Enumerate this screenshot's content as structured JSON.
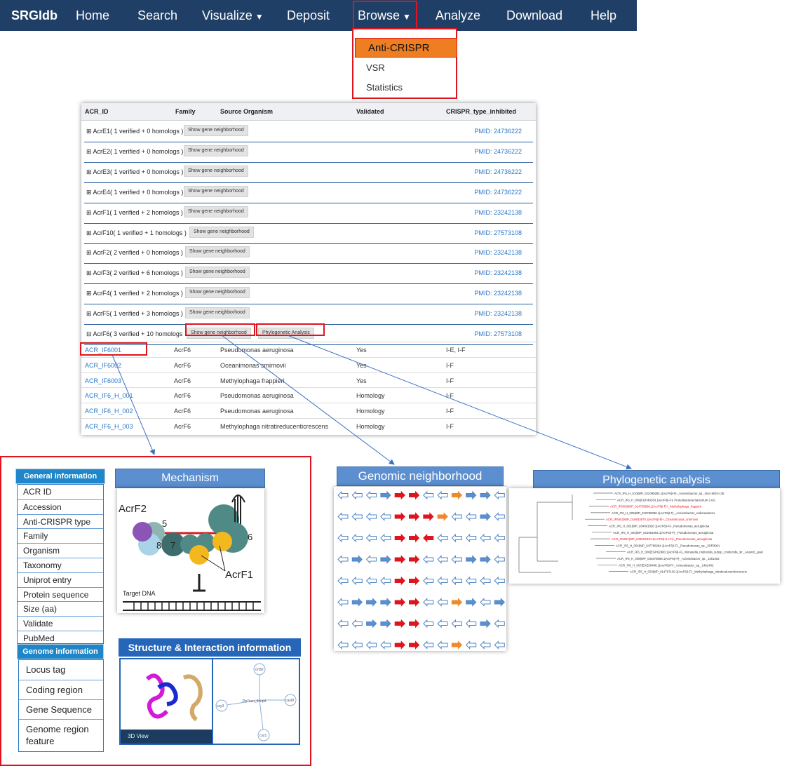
{
  "navbar": {
    "brand": "SRGIdb",
    "items": [
      "Home",
      "Search",
      "Visualize",
      "Deposit",
      "Browse",
      "Analyze",
      "Download",
      "Help"
    ]
  },
  "dropdown": {
    "items": [
      "Anti-CRISPR",
      "VSR",
      "Statistics"
    ]
  },
  "table": {
    "headers": [
      "ACR_ID",
      "Family",
      "Source Organism",
      "Validated",
      "CRISPR_type_inhibited"
    ],
    "groups": [
      {
        "label": "⊞ AcrE1( 1 verified + 0 homologs )",
        "pmid": "PMID: 24736222"
      },
      {
        "label": "⊞ AcrE2( 1 verified + 0 homologs )",
        "pmid": "PMID: 24736222"
      },
      {
        "label": "⊞ AcrE3( 1 verified + 0 homologs )",
        "pmid": "PMID: 24736222"
      },
      {
        "label": "⊞ AcrE4( 1 verified + 0 homologs )",
        "pmid": "PMID: 24736222"
      },
      {
        "label": "⊞ AcrF1( 1 verified + 2 homologs )",
        "pmid": "PMID: 23242138"
      },
      {
        "label": "⊞ AcrF10( 1 verified + 1 homologs )",
        "pmid": "PMID: 27573108"
      },
      {
        "label": "⊞ AcrF2( 2 verified + 0 homologs )",
        "pmid": "PMID: 23242138"
      },
      {
        "label": "⊞ AcrF3( 2 verified + 6 homologs )",
        "pmid": "PMID: 23242138"
      },
      {
        "label": "⊞ AcrF4( 1 verified + 2 homologs )",
        "pmid": "PMID: 23242138"
      },
      {
        "label": "⊞ AcrF5( 1 verified + 3 homologs )",
        "pmid": "PMID: 23242138"
      },
      {
        "label": "⊟ AcrF6( 3 verified + 10 homologs",
        "pmid": "PMID: 27573108"
      }
    ],
    "gene_button": "Show gene neighborhood",
    "phylo_button": "Phylogenetic Analysis",
    "rows": [
      {
        "id": "ACR_IF6001",
        "family": "AcrF6",
        "organism": "Pseudomonas aeruginosa",
        "validated": "Yes",
        "type": "I-E, I-F"
      },
      {
        "id": "ACR_IF6002",
        "family": "AcrF6",
        "organism": "Oceanimonas smirnovii",
        "validated": "Yes",
        "type": "I-F"
      },
      {
        "id": "ACR_IF6003",
        "family": "AcrF6",
        "organism": "Methylophaga frappieri",
        "validated": "Yes",
        "type": "I-F"
      },
      {
        "id": "ACR_IF6_H_001",
        "family": "AcrF6",
        "organism": "Pseudomonas aeruginosa",
        "validated": "Homology",
        "type": "I-F"
      },
      {
        "id": "ACR_IF6_H_002",
        "family": "AcrF6",
        "organism": "Pseudomonas aeruginosa",
        "validated": "Homology",
        "type": "I-F"
      },
      {
        "id": "ACR_IF6_H_003",
        "family": "AcrF6",
        "organism": "Methylophaga nitratireducenticrescens",
        "validated": "Homology",
        "type": "I-F"
      }
    ]
  },
  "detail": {
    "general_header": "General information",
    "general_items": [
      "ACR ID",
      "Accession",
      "Anti-CRISPR type",
      "Family",
      "Organism",
      "Taxonomy",
      "Uniprot entry",
      "Protein sequence",
      "Size (aa)",
      "Validate",
      "PubMed"
    ],
    "genome_header": "Genome information",
    "genome_items": [
      "Locus tag",
      "Coding region",
      "Gene Sequence",
      "Genome region feature"
    ],
    "mechanism_title": "Mechanism",
    "mechanism_labels": {
      "acrf2": "AcrF2",
      "acrf1": "AcrF1",
      "target": "Target DNA",
      "n5": "5",
      "n6": "6",
      "n7": "7",
      "n8": "8"
    },
    "structure_title": "Structure & Interaction information",
    "viewer_label": "3D View",
    "net_nodes": [
      "orf30",
      "Pp7seri_6cupd",
      "csy3",
      "cas6f",
      "csy1"
    ]
  },
  "genomic_title": "Genomic neighborhood",
  "phylo_title": "Phylogenetic analysis",
  "phylo_leaves": [
    "ACR_IF6_H_010|WP_022099284.1|AcrF6|I-F|-_Acinetobacter_sp._NS4 MG5-135",
    "ACR_IF6_H_009|CDH40283.1|AcrF6|I-F|- Proteobacteria bacterium CAG",
    "ACR_IF6003|WP_014705806.1|AcrF6|I-F|+_Methylophaga_frappieri",
    "ACR_IF6_H_005|WP_010768030.1|AcrF6|I-F|-_Acinetobacter_radioresistens",
    "ACR_IF6002|WP_019933870.1|AcrF6|I-F|+_Oceanimonas_smirnovii",
    "ACR_IF6_H_001|WP_034001826.1|AcrF6|I-F|-_Pseudomonas_aeruginosa",
    "ACR_IF6_H_002|WP_031691692.1|AcrF6|I-F|-_Pseudomonas_aeruginosa",
    "ACR_IF6001|WP_043004810.1|AcrF6|I-E,I-F|+_Pseudomonas_aeruginosa",
    "ACR_IF6_H_004|WP_047789284.1|AcrF6|I-F|-_Pseudomonas_sp._2DR3001",
    "ACR_IF6_H_006|EGP62980.1|AcrF6|I-F|-_Moraxella_multocida_subsp._multocida_str._Anand1_goat",
    "ACR_IF6_H_008|WP_034678508.1|AcrF6|I-F|-_Acinetobacter_sp._1461402",
    "ACR_IF6_H_007|EXE30408.1|AcrF6|I-F|-_Acinetobacter_sp._1461402",
    "ACR_IF6_H_003|WP_014707130.1|AcrF6|I-F|-_Methylophaga_nitratireducenticrescens"
  ],
  "colors": {
    "navbar": "#1f3f66",
    "highlight": "#e0141e",
    "active": "#ef7d22",
    "link": "#2a77c9",
    "panel_title": "#5b8fd0"
  }
}
